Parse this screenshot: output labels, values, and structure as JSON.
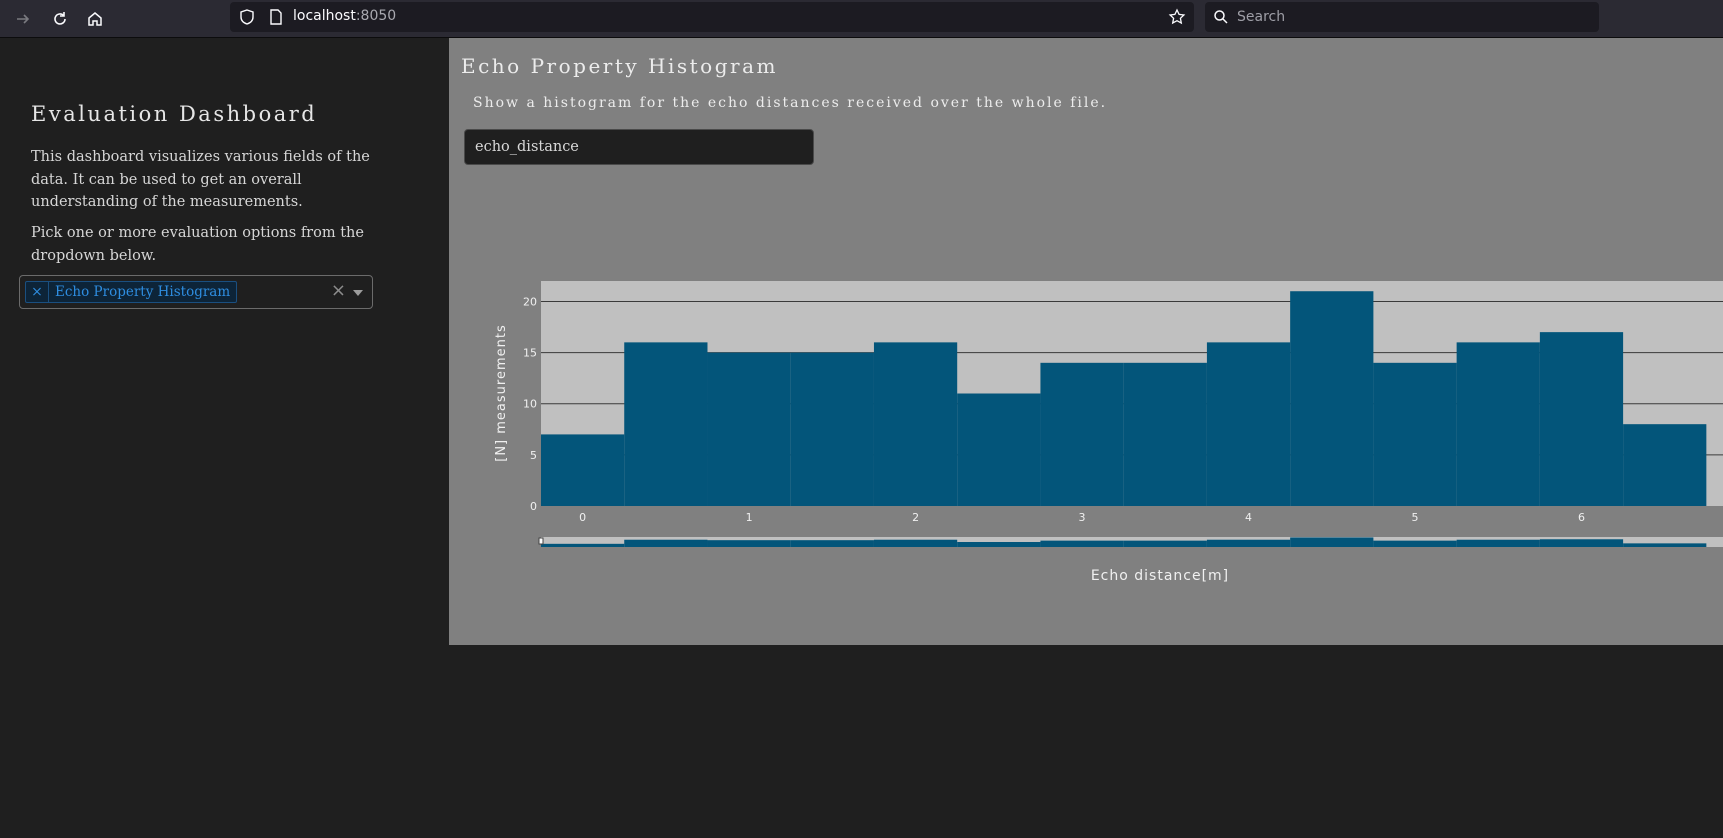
{
  "browser": {
    "url_host": "localhost",
    "url_port": ":8050",
    "search_placeholder": "Search"
  },
  "sidebar": {
    "title": "Evaluation Dashboard",
    "description": "This dashboard visualizes various fields of the data. It can be used to get an overall understanding of the measurements.",
    "instruction": "Pick one or more evaluation options from the dropdown below.",
    "dropdown": {
      "selected": [
        "Echo Property Histogram"
      ],
      "clear_glyph": "×",
      "remove_glyph": "×"
    }
  },
  "main": {
    "title": "Echo Property Histogram",
    "description": "Show a histogram for the echo distances received over the whole file.",
    "field_value": "echo_distance"
  },
  "colors": {
    "bar": "#03557a",
    "plot_bg": "#c0c0c0",
    "panel_bg": "#808080",
    "page_bg": "#1f1f1f",
    "accent": "#2e8de0"
  },
  "chart_data": {
    "type": "bar",
    "xlabel": "Echo distance[m]",
    "ylabel": "[N] measurements",
    "bin_width": 0.5,
    "x_tick_values": [
      0,
      1,
      2,
      3,
      4,
      5,
      6
    ],
    "x_tick_labels": [
      "0",
      "1",
      "2",
      "3",
      "4",
      "5",
      "6"
    ],
    "y_tick_values": [
      0,
      5,
      10,
      15,
      20
    ],
    "y_tick_labels": [
      "0",
      "5",
      "10",
      "15",
      "20"
    ],
    "ylim": [
      0,
      22
    ],
    "xlim": [
      -0.25,
      6.85
    ],
    "grid": true,
    "rangeslider": true,
    "bins": [
      {
        "x": 0.0,
        "count": 7
      },
      {
        "x": 0.5,
        "count": 16
      },
      {
        "x": 1.0,
        "count": 15
      },
      {
        "x": 1.5,
        "count": 15
      },
      {
        "x": 2.0,
        "count": 16
      },
      {
        "x": 2.5,
        "count": 11
      },
      {
        "x": 3.0,
        "count": 14
      },
      {
        "x": 3.5,
        "count": 14
      },
      {
        "x": 4.0,
        "count": 16
      },
      {
        "x": 4.5,
        "count": 21
      },
      {
        "x": 5.0,
        "count": 14
      },
      {
        "x": 5.5,
        "count": 16
      },
      {
        "x": 6.0,
        "count": 17
      },
      {
        "x": 6.5,
        "count": 8
      }
    ]
  }
}
